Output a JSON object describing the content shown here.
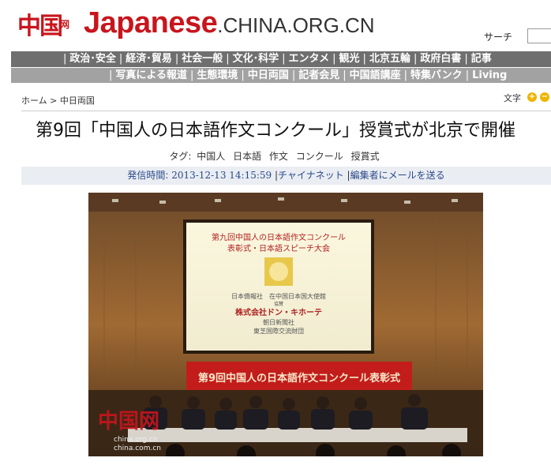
{
  "header": {
    "logo_cn": "中国",
    "logo_net": "网",
    "title_main": "Japanese",
    "title_domain": ".CHINA.ORG.CN",
    "search_label": "サーチ"
  },
  "nav_primary": [
    "政治･安全",
    "経済･貿易",
    "社会一般",
    "文化･科学",
    "エンタメ",
    "観光",
    "北京五輪",
    "政府白書",
    "記事"
  ],
  "nav_secondary": [
    "写真による報道",
    "生態環境",
    "中日両国",
    "記者会見",
    "中国語講座",
    "特集バンク",
    "Living"
  ],
  "breadcrumb": {
    "home": "ホーム",
    "sep": ">",
    "section": "中日両国"
  },
  "font_size": {
    "label": "文字",
    "increase": "+",
    "decrease": "−"
  },
  "article": {
    "headline": "第9回「中国人の日本語作文コンクール」授賞式が北京で開催",
    "tags_label": "タグ:",
    "tags": [
      "中国人",
      "日本語",
      "作文",
      "コンクール",
      "授賞式"
    ],
    "meta_label": "発信時間:",
    "meta_date": "2013-12-13 14:15:59",
    "meta_sep1": "|",
    "source": "チャイナネット",
    "meta_sep2": "|",
    "mail_link": "編集者にメールを送る"
  },
  "photo": {
    "screen_line1": "第九回中国人の日本語作文コンクール",
    "screen_line2": "表彰式・日本語スピーチ大会",
    "screen_org1": "日本僑報社　在中国日本国大使館",
    "screen_org_small": "協賛",
    "screen_org2": "株式会社ドン・キホーテ",
    "screen_org3": "朝日新聞社",
    "screen_org4": "東芝国際交流財団",
    "banner": "第9回中国人の日本語作文コンクール表彰式",
    "watermark_cn": "中国网",
    "watermark_url1": "china.org.cn",
    "watermark_url2": "china.com.cn"
  },
  "colors": {
    "brand_red": "#c8151d",
    "nav1_bg": "#6f6f6f",
    "nav2_bg": "#a2a2a2",
    "meta_bg": "#eaedf2"
  }
}
